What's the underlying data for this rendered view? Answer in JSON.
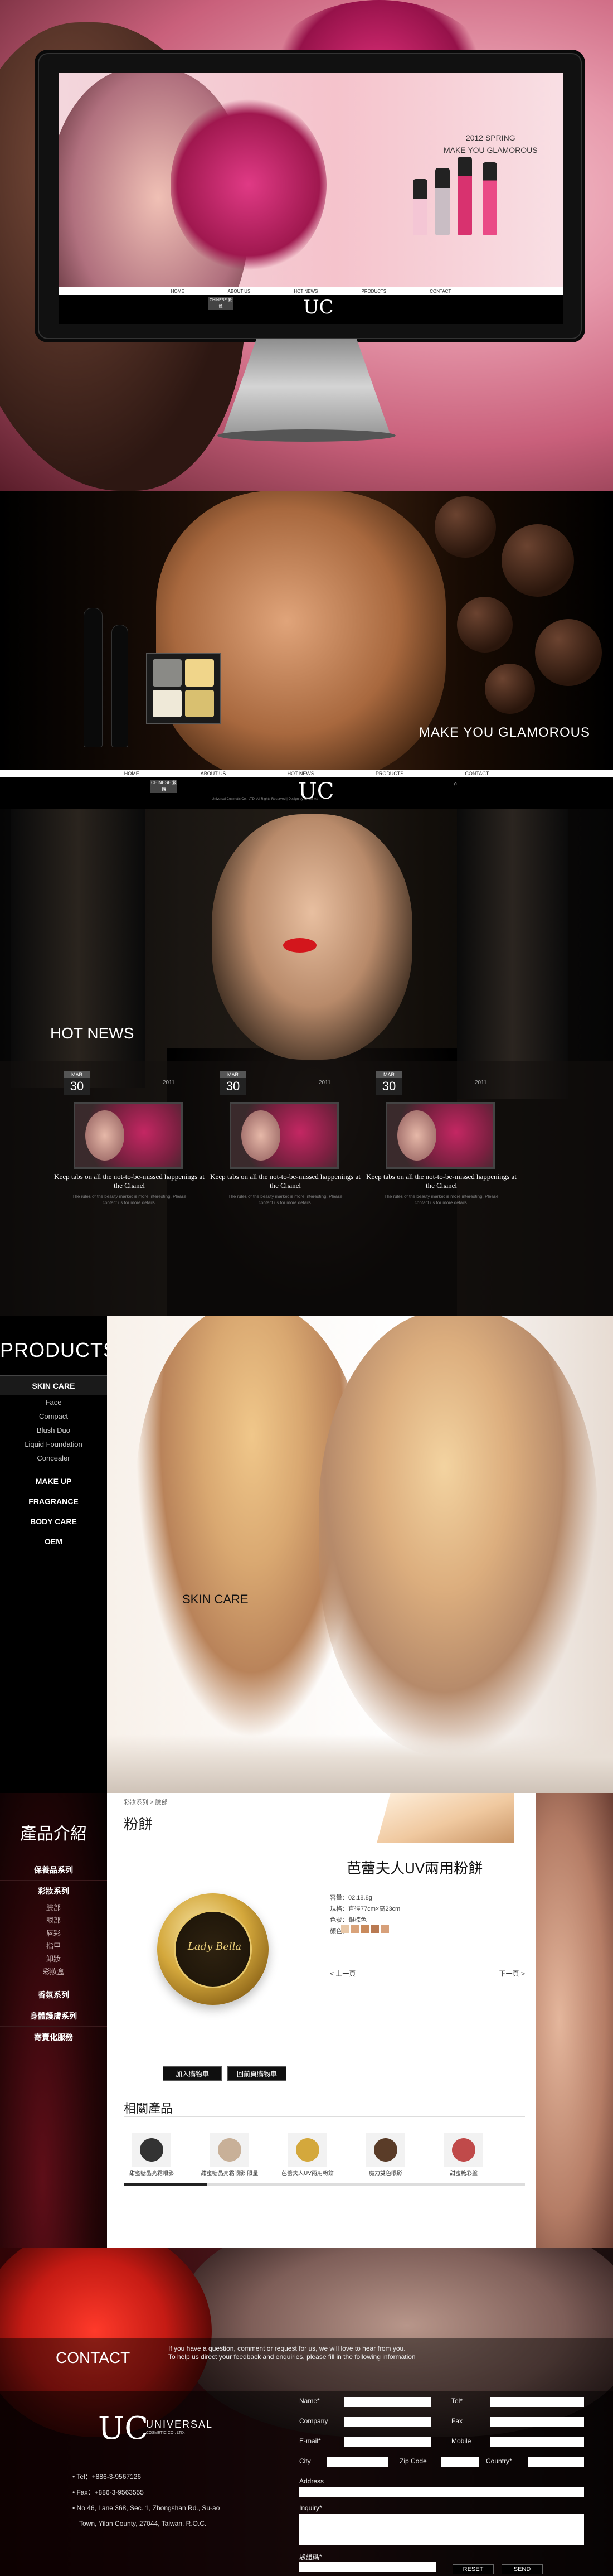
{
  "hero": {
    "season": "2012 SPRING",
    "tagline": "MAKE YOU GLAMOROUS",
    "screen_nav": [
      "HOME",
      "ABOUT US",
      "HOT NEWS",
      "PRODUCTS",
      "CONTACT"
    ],
    "lang_label": "CHINESE 繁體",
    "logo": "UC"
  },
  "banner2": {
    "tagline": "MAKE YOU GLAMOROUS",
    "nav": [
      "HOME",
      "ABOUT US",
      "HOT NEWS",
      "PRODUCTS",
      "CONTACT"
    ],
    "lang_label": "CHINESE 繁體",
    "logo": "UC",
    "copyright": "Universal Cosmetic Co., LTD. All Rights Reserved | Design by Cheer Ad"
  },
  "news": {
    "title": "HOT NEWS",
    "items": [
      {
        "month": "MAR",
        "day": "30",
        "year": "2011",
        "headline": "Keep tabs on all the not-to-be-missed happenings at the Chanel",
        "body": "The rules of the beauty market is more interesting. Please contact us for more details."
      },
      {
        "month": "MAR",
        "day": "30",
        "year": "2011",
        "headline": "Keep tabs on all the not-to-be-missed happenings at the Chanel",
        "body": "The rules of the beauty market is more interesting. Please contact us for more details."
      },
      {
        "month": "MAR",
        "day": "30",
        "year": "2011",
        "headline": "Keep tabs on all the not-to-be-missed happenings at the Chanel",
        "body": "The rules of the beauty market is more interesting. Please contact us for more details."
      }
    ]
  },
  "products": {
    "title": "PRODUCTS",
    "menu": [
      {
        "label": "SKIN CARE",
        "active": true,
        "sub": [
          "Face",
          "Compact",
          "Blush Duo",
          "Liquid Foundation",
          "Concealer"
        ]
      },
      {
        "label": "MAKE UP",
        "active": false,
        "sub": []
      },
      {
        "label": "FRAGRANCE",
        "active": false,
        "sub": []
      },
      {
        "label": "BODY CARE",
        "active": false,
        "sub": []
      },
      {
        "label": "OEM",
        "active": false,
        "sub": []
      }
    ],
    "hero_label": "SKIN CARE"
  },
  "detail": {
    "side_title": "產品介紹",
    "menu": [
      {
        "label": "保養品系列",
        "sub": []
      },
      {
        "label": "彩妝系列",
        "sub": [
          "臉部",
          "眼部",
          "唇彩",
          "指甲",
          "卸妝",
          "彩妝盒"
        ]
      },
      {
        "label": "香氛系列",
        "sub": []
      },
      {
        "label": "身體護膚系列",
        "sub": []
      },
      {
        "label": "寄賣化服務",
        "sub": []
      }
    ],
    "breadcrumb": "彩妝系列 > 臉部",
    "heading": "粉餅",
    "compact_brand": "Lady Bella",
    "product_name": "芭蕾夫人UV兩用粉餅",
    "specs": [
      "容量：02.18.8g",
      "規格：直徑77cm×高23cm",
      "色號：銀棕色",
      "顏色："
    ],
    "color_swatches": [
      "#e8c8a8",
      "#d9a37a",
      "#c98a5c",
      "#b97a52",
      "#d7a07a"
    ],
    "prev": "< 上一頁",
    "next": "下一頁 >",
    "buy_button": "加入購物車",
    "back_button": "回前頁購物車",
    "related_title": "相關產品",
    "related": [
      {
        "label": "甜蜜糖晶亮霜眼影",
        "swatch": "#333333"
      },
      {
        "label": "甜蜜糖晶亮霜眼影 限量",
        "swatch": "#c8b098"
      },
      {
        "label": "芭蕾夫人UV兩用粉餅",
        "swatch": "#d4a83c"
      },
      {
        "label": "魔力雙色眼影",
        "swatch": "#5a3c28"
      },
      {
        "label": "甜蜜糖彩盤",
        "swatch": "#c04a4a"
      }
    ]
  },
  "contact": {
    "title": "CONTACT",
    "intro1": "If you have a question, comment or request for us, we will love to hear from you.",
    "intro2": "To help us direct your feedback and enquiries, please fill in the following information",
    "logo": "UC",
    "company": "UNIVERSAL",
    "company_sub": "COSMETIC CO., LTD.",
    "address": [
      "Tel：+886-3-9567126",
      "Fax：+886-3-9563555",
      "No.46, Lane 368, Sec. 1, Zhongshan Rd., Su-ao",
      "Town, Yilan County, 27044, Taiwan, R.O.C."
    ],
    "labels": {
      "name": "Name*",
      "tel": "Tel*",
      "company": "Company",
      "fax": "Fax",
      "email": "E-mail*",
      "mobile": "Mobile",
      "city": "City",
      "zip": "Zip Code",
      "country": "Country*",
      "address": "Address",
      "inquiry": "Inquiry*",
      "captcha": "驗證碼*"
    },
    "reset": "RESET",
    "send": "SEND"
  }
}
